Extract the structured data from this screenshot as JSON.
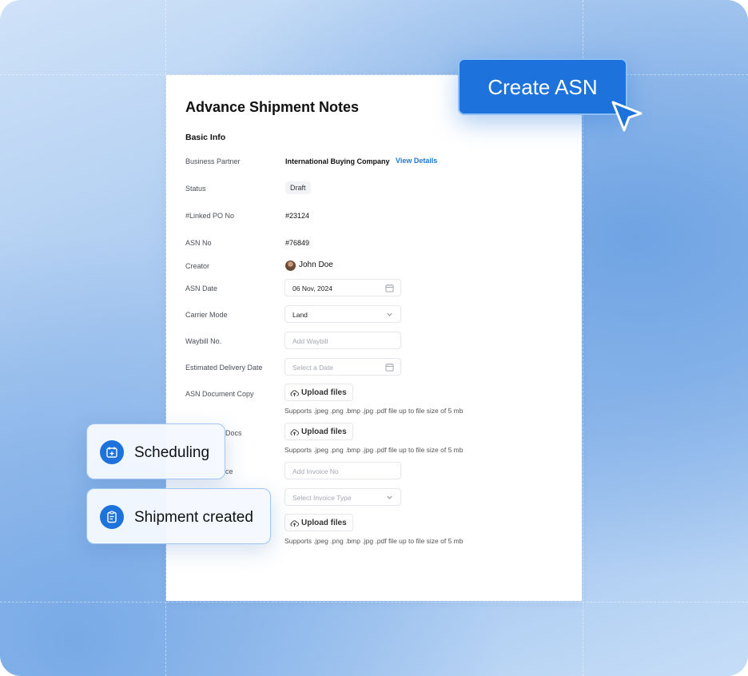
{
  "colors": {
    "accent": "#1d73db",
    "link": "#1e78d6",
    "chip_border": "#9ec6f1"
  },
  "panel": {
    "title": "Advance Shipment Notes",
    "section": "Basic Info",
    "fields": {
      "business_partner": {
        "label": "Business Partner",
        "value": "International Buying Company",
        "link": "View Details"
      },
      "status": {
        "label": "Status",
        "value": "Draft"
      },
      "linked_po": {
        "label": "#Linked PO No",
        "value": "#23124"
      },
      "asn_no": {
        "label": "ASN No",
        "value": "#76849"
      },
      "creator": {
        "label": "Creator",
        "value": "John Doe",
        "icon": "avatar"
      },
      "asn_date": {
        "label": "ASN Date",
        "value": "06 Nov, 2024",
        "icon": "calendar-icon"
      },
      "carrier_mode": {
        "label": "Carrier Mode",
        "value": "Land",
        "icon": "chevron-down-icon"
      },
      "waybill": {
        "label": "Waybill No.",
        "placeholder": "Add Waybill"
      },
      "est_delivery": {
        "label": "Estimated Delivery Date",
        "placeholder": "Select a Date",
        "icon": "calendar-icon"
      },
      "asn_doc": {
        "label": "ASN Document Copy",
        "upload": "Upload files",
        "hint": "Supports .jpeg .png .bmp .jpg .pdf file up to file size of 5 mb"
      },
      "other_docs": {
        "label": "Docs",
        "upload": "Upload files",
        "hint": "Supports .jpeg .png .bmp .jpg .pdf file up to file size of 5 mb"
      },
      "invoice": {
        "label": "ce",
        "placeholder": "Add Invoice No"
      },
      "invoice_type": {
        "placeholder": "Select Invoice Type",
        "icon": "chevron-down-icon"
      },
      "invoice_doc": {
        "upload": "Upload files",
        "hint": "Supports .jpeg .png .bmp .jpg .pdf file up to file size of 5 mb"
      }
    }
  },
  "cta": {
    "label": "Create ASN"
  },
  "chips": {
    "scheduling": {
      "label": "Scheduling",
      "icon": "calendar-plus-icon"
    },
    "shipment": {
      "label": "Shipment created",
      "icon": "clipboard-icon"
    }
  }
}
